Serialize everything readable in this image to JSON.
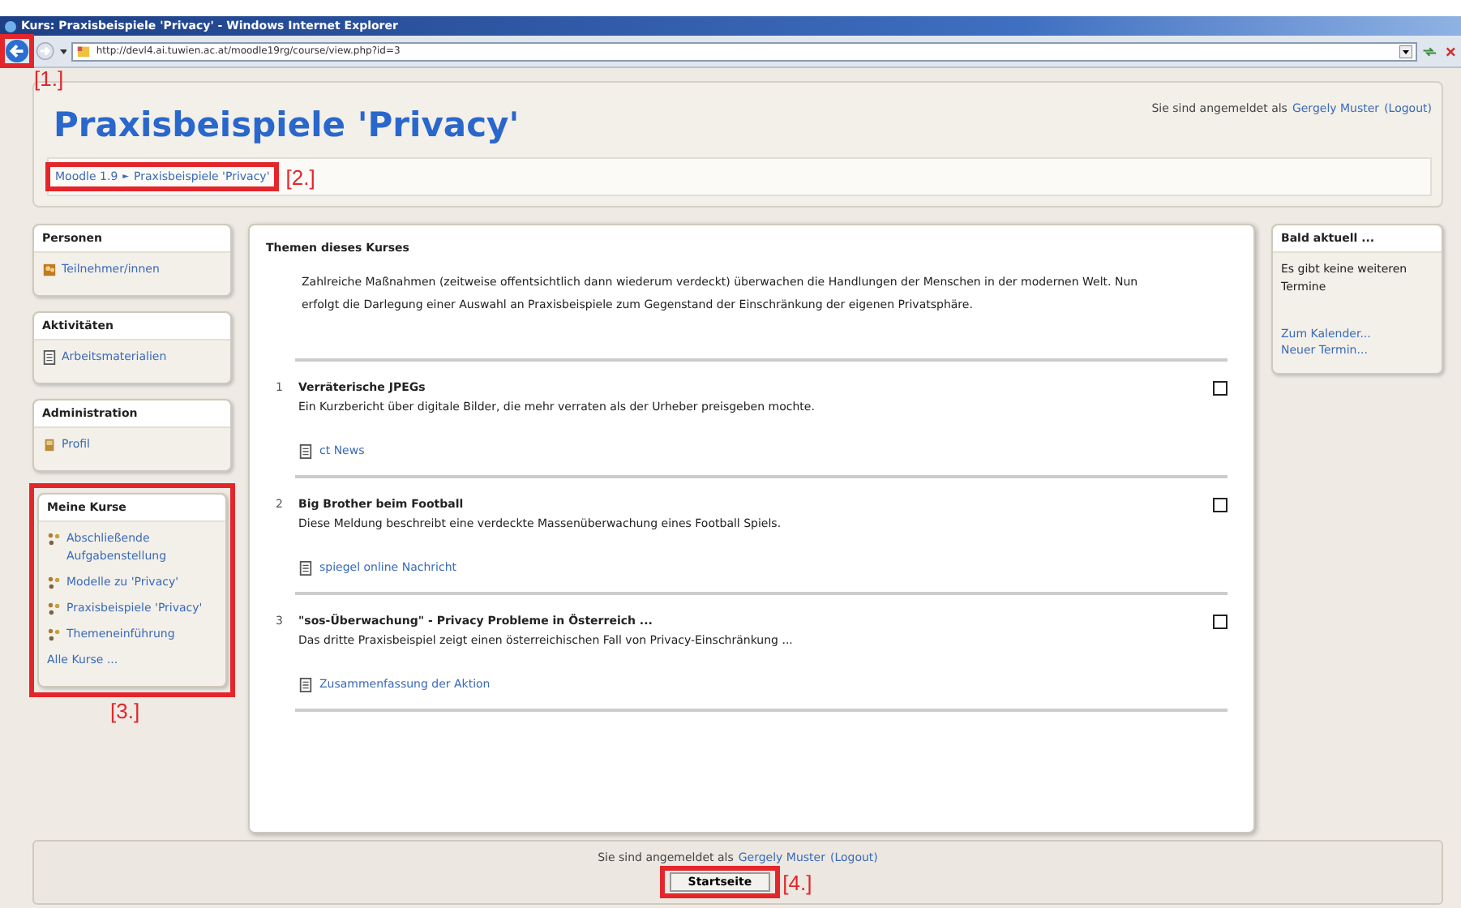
{
  "window": {
    "title": "Kurs: Praxisbeispiele 'Privacy' - Windows Internet Explorer",
    "url": "http://devl4.ai.tuwien.ac.at/moodle19rg/course/view.php?id=3"
  },
  "header": {
    "title": "Praxisbeispiele 'Privacy'",
    "login_prefix": "Sie sind angemeldet als",
    "user": "Gergely Muster",
    "logout": "(Logout)"
  },
  "breadcrumb": {
    "items": [
      "Moodle 1.9",
      "Praxisbeispiele 'Privacy'"
    ],
    "separator": "►"
  },
  "left_blocks": [
    {
      "title": "Personen",
      "items": [
        {
          "label": "Teilnehmer/innen",
          "kind": "people"
        }
      ]
    },
    {
      "title": "Aktivitäten",
      "items": [
        {
          "label": "Arbeitsmaterialien",
          "kind": "document"
        }
      ]
    },
    {
      "title": "Administration",
      "items": [
        {
          "label": "Profil",
          "kind": "profile"
        }
      ]
    },
    {
      "title": "Meine Kurse",
      "items": [
        {
          "label": "Abschließende Aufgabenstellung",
          "kind": "course"
        },
        {
          "label": "Modelle zu 'Privacy'",
          "kind": "course"
        },
        {
          "label": "Praxisbeispiele 'Privacy'",
          "kind": "course"
        },
        {
          "label": "Themeneinführung",
          "kind": "course"
        },
        {
          "label": "Alle Kurse ...",
          "kind": "link"
        }
      ]
    }
  ],
  "main": {
    "title": "Themen dieses Kurses",
    "intro": "Zahlreiche Maßnahmen (zeitweise offentsichtlich dann wiederum verdeckt) überwachen die Handlungen der Menschen in der modernen Welt. Nun erfolgt die Darlegung einer Auswahl an Praxisbeispiele zum Gegenstand der Einschränkung der eigenen Privatsphäre.",
    "sections": [
      {
        "number": "1",
        "title": "Verräterische JPEGs",
        "summary": "Ein Kurzbericht über digitale Bilder, die mehr verraten als der Urheber preisgeben mochte.",
        "resource": "ct News"
      },
      {
        "number": "2",
        "title": "Big Brother beim Football",
        "summary": "Diese Meldung beschreibt eine verdeckte Massenüberwachung eines Football Spiels.",
        "resource": "spiegel online Nachricht"
      },
      {
        "number": "3",
        "title": "\"sos-Überwachung\" - Privacy Probleme in Österreich ...",
        "summary": "Das dritte Praxisbeispiel zeigt einen österreichischen Fall von Privacy-Einschränkung ...",
        "resource": "Zusammenfassung der Aktion"
      }
    ]
  },
  "right_block": {
    "title": "Bald aktuell ...",
    "text": "Es gibt keine weiteren Termine",
    "links": [
      "Zum Kalender...",
      "Neuer Termin..."
    ]
  },
  "footer": {
    "login_prefix": "Sie sind angemeldet als",
    "user": "Gergely Muster",
    "logout": "(Logout)",
    "button": "Startseite"
  },
  "annotations": [
    {
      "label": "[1.]",
      "kind": "back"
    },
    {
      "label": "[2.]",
      "kind": "breadcrumb"
    },
    {
      "label": "[3.]",
      "kind": "courses"
    },
    {
      "label": "[4.]",
      "kind": "home"
    }
  ]
}
